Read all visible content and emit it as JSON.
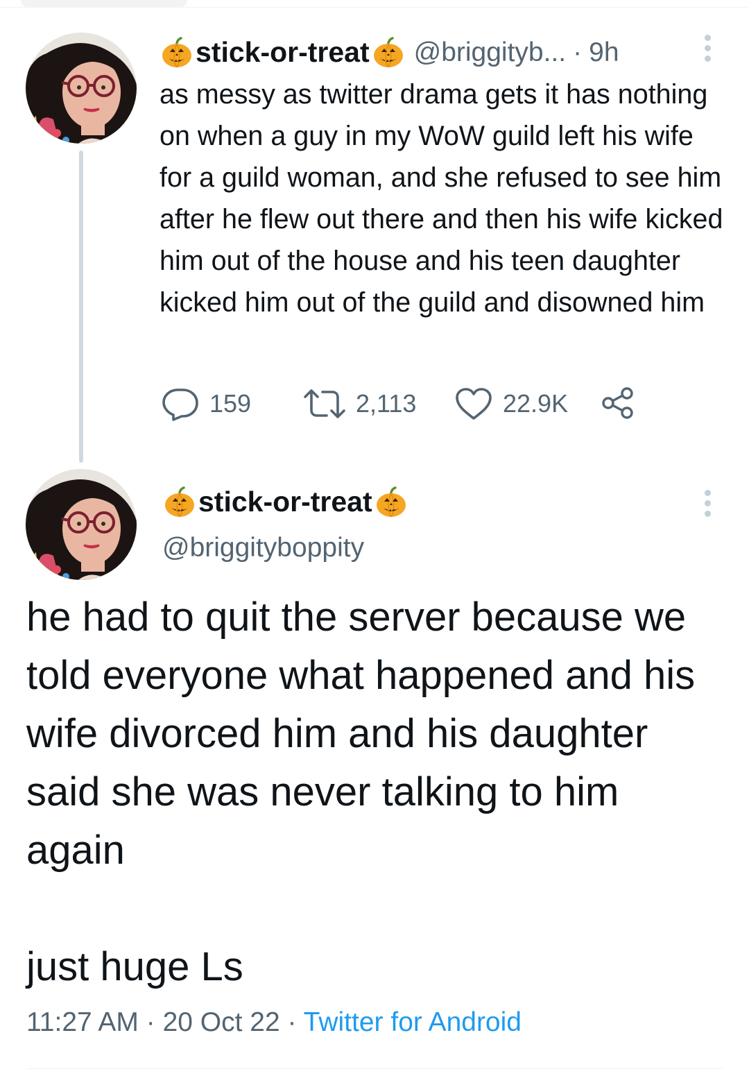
{
  "thread": {
    "tweet1": {
      "display_name": "stick-or-treat",
      "handle": "@briggityb...",
      "separator": "·",
      "time": "9h",
      "text": "as messy as twitter drama gets it has nothing on when a guy in my WoW guild left his wife for a guild woman, and she refused to see him after he flew out there and then his wife kicked him out of the house and his teen daughter kicked him out of the guild and disowned him",
      "replies": "159",
      "retweets": "2,113",
      "likes": "22.9K"
    },
    "tweet2": {
      "display_name": "stick-or-treat",
      "handle": "@briggityboppity",
      "text_para1": "he had to quit the server because we told everyone what happened and his wife divorced him and his daughter said she was never talking to him again",
      "text_para2": "just huge Ls",
      "time": "11:27 AM",
      "date": "20 Oct 22",
      "sep1": "·",
      "sep2": "·",
      "source": "Twitter for Android"
    }
  },
  "icons": {
    "pumpkin": "jack-o-lantern-icon",
    "more": "more-vertical-icon",
    "reply": "reply-icon",
    "retweet": "retweet-icon",
    "like": "heart-icon",
    "share": "share-icon"
  },
  "colors": {
    "text": "#0f1419",
    "secondary": "#536471",
    "link": "#1d9bf0",
    "pumpkin": "#f5a623",
    "thread_line": "#cfd9de"
  }
}
